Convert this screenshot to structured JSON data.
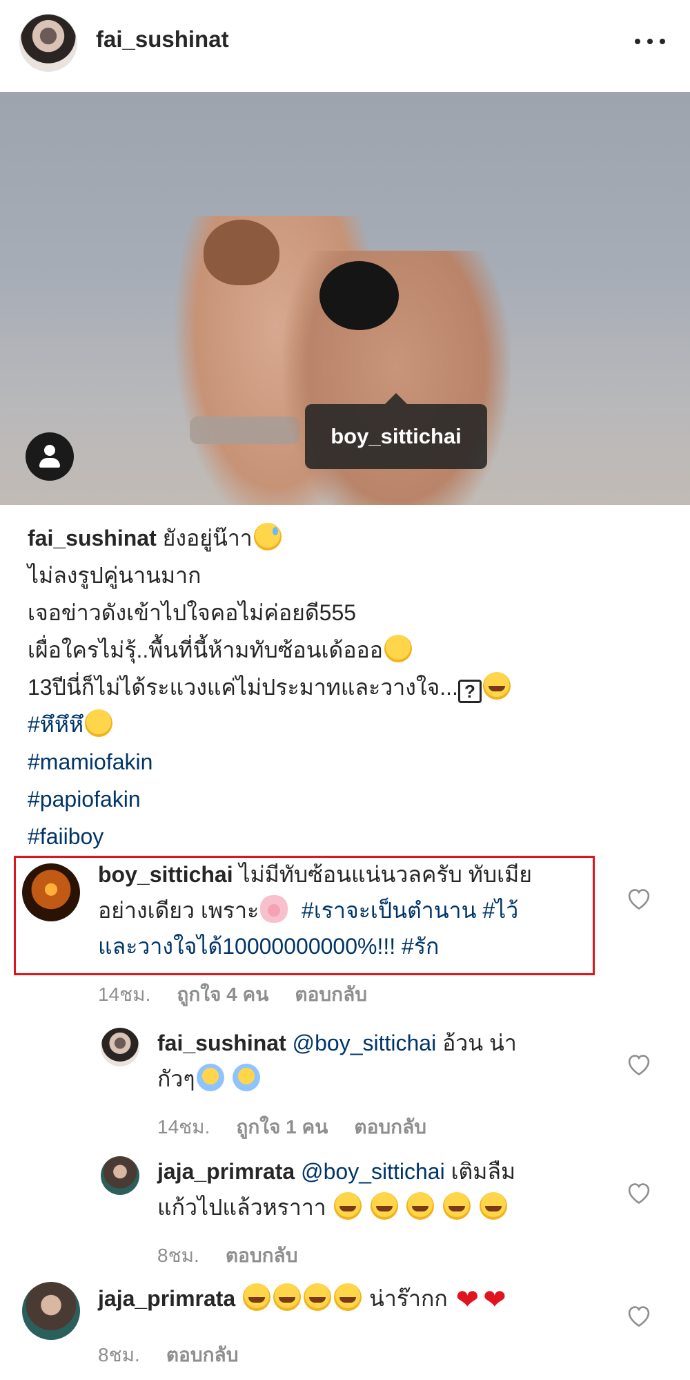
{
  "header": {
    "username": "fai_sushinat"
  },
  "photo": {
    "tag_label": "boy_sittichai"
  },
  "caption": {
    "username": "fai_sushinat",
    "first_line_text": "ยังอยู่น๊าา",
    "lines": [
      "ไม่ลงรูปคู่นานมาก",
      "เจอข่าวดังเข้าไปใจคอไม่ค่อยดี555",
      "เผื่อใครไม่รุ้..พื้นที่นี้ห้ามทับซ้อนเด้อออ",
      "13ปีนี่ก็ไม่ได้ระแวงแค่ไม่ประมาทและวางใจ..."
    ],
    "hashtag_emoji_line": "#หึหึหึ",
    "hashtags": [
      "#mamiofakin",
      "#papiofakin",
      "#faiiboy"
    ]
  },
  "comments": [
    {
      "username": "boy_sittichai",
      "text_line1": "ไม่มีทับซ้อนแน่นวลครับ ทับเมีย",
      "text_line2a": "อย่างเดียว เพราะ",
      "text_line2_tags": "#เราจะเป็นตำนาน #ไว้",
      "text_line3_tags": "และวางใจได้10000000000%!!! #รัก",
      "time": "14ชม.",
      "likes": "ถูกใจ 4 คน",
      "reply": "ตอบกลับ"
    },
    {
      "username": "fai_sushinat",
      "mention": "@boy_sittichai",
      "text_line1": "อ้วน น่า",
      "text_line2": "กัวๆ",
      "time": "14ชม.",
      "likes": "ถูกใจ 1 คน",
      "reply": "ตอบกลับ"
    },
    {
      "username": "jaja_primrata",
      "mention": "@boy_sittichai",
      "text_line1": "เติมลืม",
      "text_line2": "แก้วไปแล้วหราาา",
      "time": "8ชม.",
      "reply": "ตอบกลับ"
    },
    {
      "username": "jaja_primrata",
      "text_line1": "น่าร๊ากก",
      "time": "8ชม.",
      "reply": "ตอบกลับ"
    }
  ],
  "colors": {
    "hashtag": "#003569",
    "highlight": "#e0141e",
    "meta": "#8e8e8e"
  },
  "icons": [
    "more-icon",
    "user-tag-icon",
    "heart-icon"
  ]
}
